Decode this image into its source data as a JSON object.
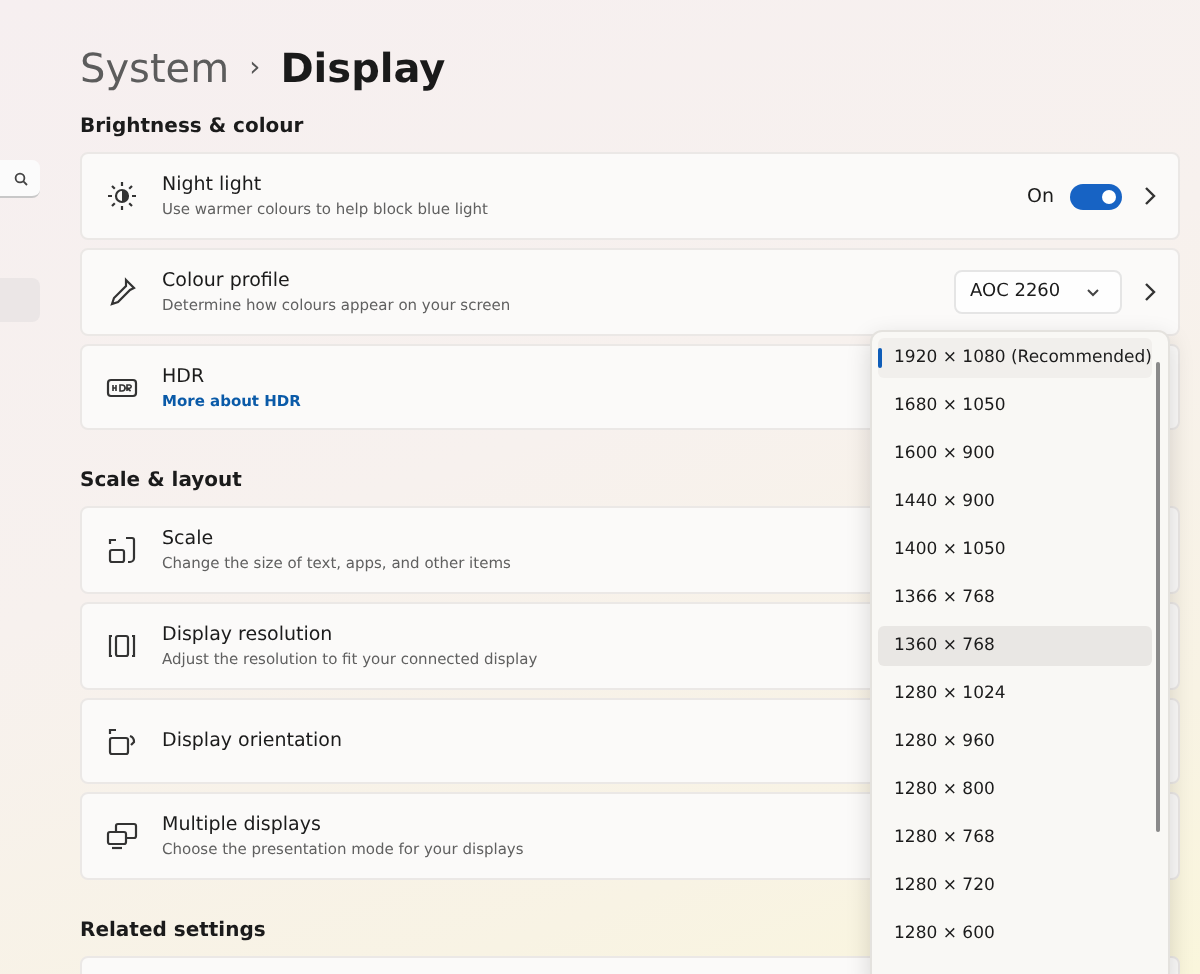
{
  "breadcrumb": {
    "parent": "System",
    "separator": "›",
    "current": "Display"
  },
  "sections": [
    {
      "title": "Brightness & colour",
      "cards": [
        {
          "title": "Night light",
          "subtitle": "Use warmer colours to help block blue light",
          "control": {
            "kind": "toggle",
            "label": "On",
            "on": true
          },
          "chevron": true
        },
        {
          "title": "Colour profile",
          "subtitle": "Determine how colours appear on your screen",
          "control": {
            "kind": "select",
            "value": "AOC 2260"
          },
          "chevron": true
        },
        {
          "title": "HDR",
          "link": "More about HDR"
        }
      ]
    },
    {
      "title": "Scale & layout",
      "cards": [
        {
          "title": "Scale",
          "subtitle": "Change the size of text, apps, and other items"
        },
        {
          "title": "Display resolution",
          "subtitle": "Adjust the resolution to fit your connected display"
        },
        {
          "title": "Display orientation"
        },
        {
          "title": "Multiple displays",
          "subtitle": "Choose the presentation mode for your displays"
        }
      ]
    },
    {
      "title": "Related settings"
    }
  ],
  "resolution_menu": {
    "options": [
      {
        "label": "1920 × 1080 (Recommended)",
        "selected": true,
        "hovered": false
      },
      {
        "label": "1680 × 1050",
        "selected": false,
        "hovered": false
      },
      {
        "label": "1600 × 900",
        "selected": false,
        "hovered": false
      },
      {
        "label": "1440 × 900",
        "selected": false,
        "hovered": false
      },
      {
        "label": "1400 × 1050",
        "selected": false,
        "hovered": false
      },
      {
        "label": "1366 × 768",
        "selected": false,
        "hovered": false
      },
      {
        "label": "1360 × 768",
        "selected": false,
        "hovered": true
      },
      {
        "label": "1280 × 1024",
        "selected": false,
        "hovered": false
      },
      {
        "label": "1280 × 960",
        "selected": false,
        "hovered": false
      },
      {
        "label": "1280 × 800",
        "selected": false,
        "hovered": false
      },
      {
        "label": "1280 × 768",
        "selected": false,
        "hovered": false
      },
      {
        "label": "1280 × 720",
        "selected": false,
        "hovered": false
      },
      {
        "label": "1280 × 600",
        "selected": false,
        "hovered": false
      }
    ]
  }
}
